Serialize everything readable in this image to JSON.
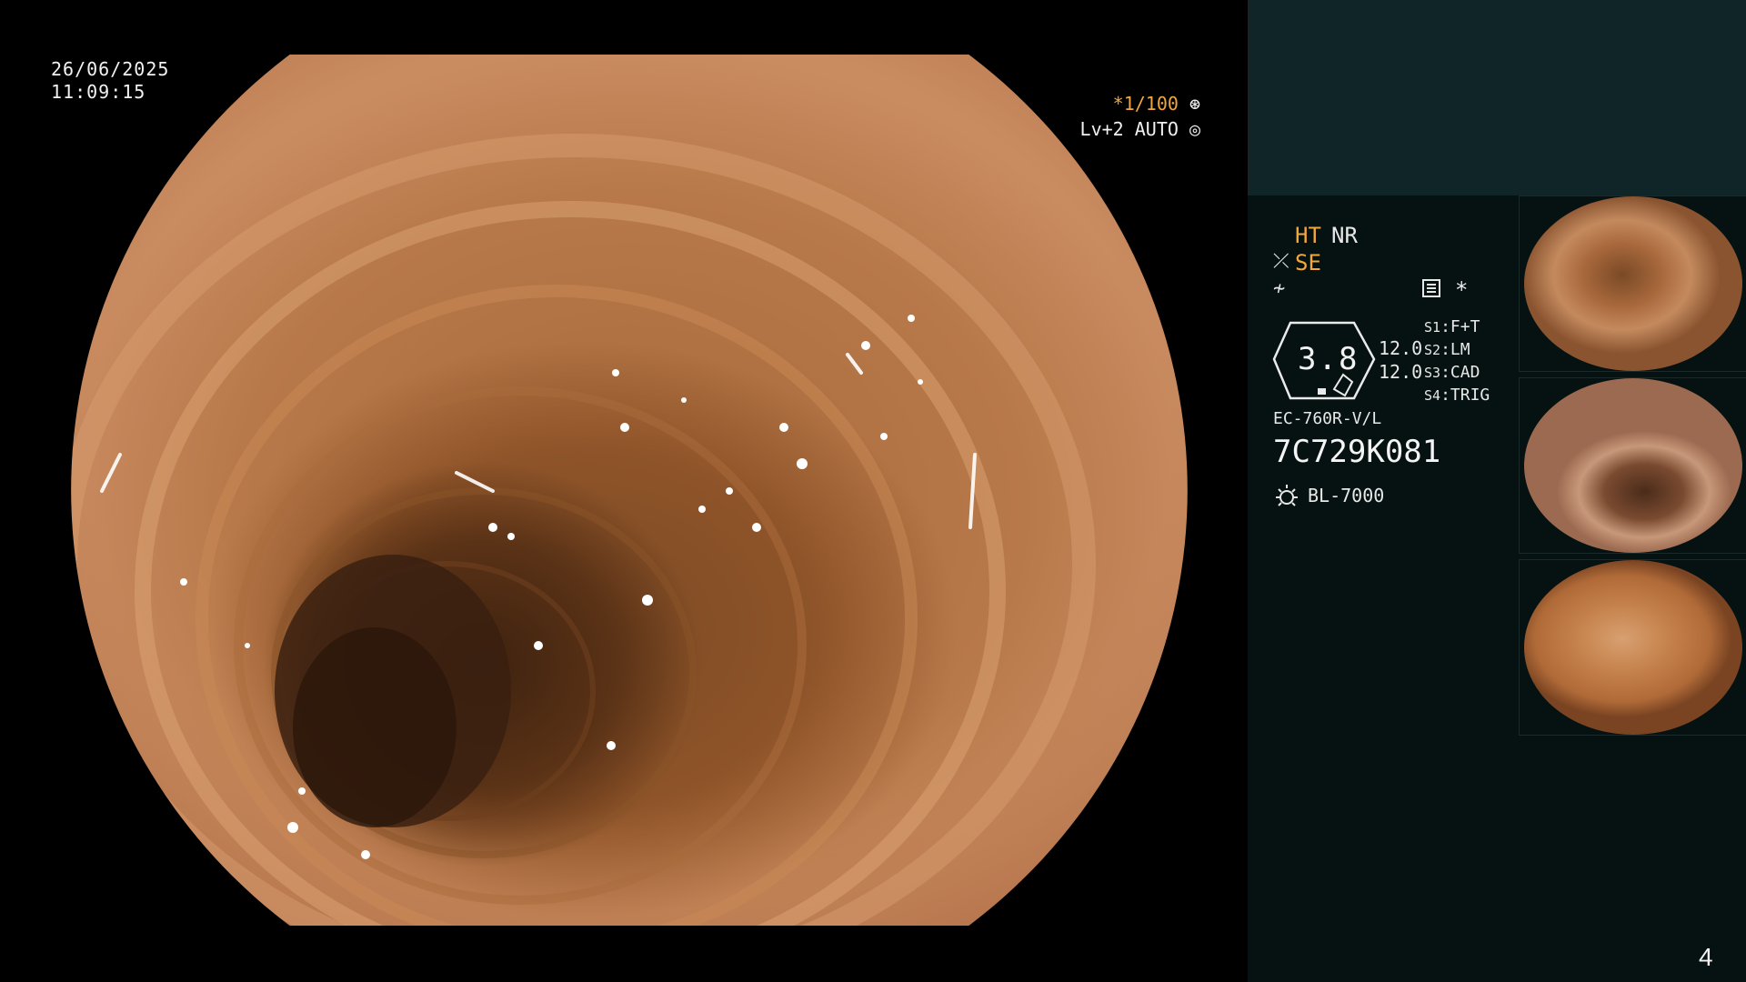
{
  "overlay": {
    "date": "26/06/2025",
    "time": "11:09:15",
    "shutter": "*1/100",
    "exposure": "Lv+2 AUTO"
  },
  "panel": {
    "ht": "HT",
    "nr": "NR",
    "se": "SE",
    "asterisk": "*",
    "zoom": "3.8",
    "ev_top": "12.0",
    "ev_bottom": "12.0",
    "switches": [
      {
        "id": "S1",
        "value": "F+T"
      },
      {
        "id": "S2",
        "value": "LM"
      },
      {
        "id": "S3",
        "value": "CAD"
      },
      {
        "id": "S4",
        "value": "TRIG"
      }
    ],
    "scope_model": "EC-760R-V/L",
    "scope_serial": "7C729K081",
    "light_source": "BL-7000",
    "page": "4"
  },
  "colors": {
    "accent_orange": "#f3a83a",
    "panel_bg": "#061111",
    "panel_top_bg": "#0f2527"
  },
  "thumbnails": [
    {
      "index": "1"
    },
    {
      "index": "2"
    },
    {
      "index": "3"
    }
  ]
}
